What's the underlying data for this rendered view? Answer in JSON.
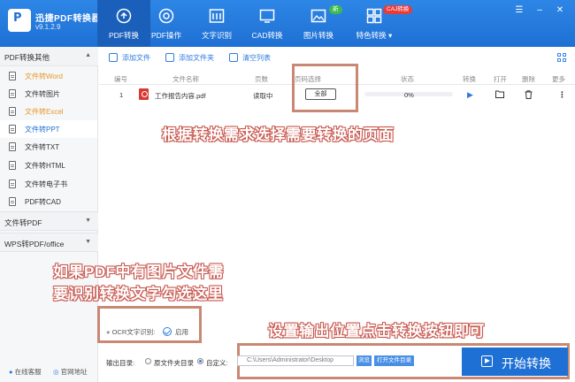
{
  "app": {
    "name": "迅捷PDF转换器",
    "version": "v9.1.2.9"
  },
  "nav": [
    {
      "label": "PDF转换",
      "icon": "pdf-convert-icon",
      "active": true
    },
    {
      "label": "PDF操作",
      "icon": "pdf-operate-icon"
    },
    {
      "label": "文字识别",
      "icon": "ocr-icon"
    },
    {
      "label": "CAD转换",
      "icon": "cad-icon"
    },
    {
      "label": "图片转换",
      "icon": "image-icon"
    },
    {
      "label": "特色转换 ▾",
      "icon": "special-icon"
    }
  ],
  "badges": {
    "new": "新",
    "cad": "CAJ转换"
  },
  "sidebar": {
    "group1": "PDF转换其他",
    "items": [
      {
        "label": "文件转Word",
        "highlight": true
      },
      {
        "label": "文件转图片"
      },
      {
        "label": "文件转Excel",
        "highlight": true
      },
      {
        "label": "文件转PPT",
        "active": true
      },
      {
        "label": "文件转TXT"
      },
      {
        "label": "文件转HTML"
      },
      {
        "label": "文件转电子书"
      },
      {
        "label": "PDF转CAD"
      }
    ],
    "group2": "文件转PDF",
    "group3": "WPS转PDF/office",
    "service": "在线客服",
    "website": "官网地址"
  },
  "toolbar": {
    "add_file": "添加文件",
    "add_folder": "添加文件夹",
    "clear_list": "清空列表"
  },
  "table": {
    "headers": [
      "编号",
      "文件名称",
      "页数",
      "页码选择",
      "状态",
      "转换",
      "打开",
      "删除",
      "更多"
    ],
    "rows": [
      {
        "num": "1",
        "name": "工作报告内容.pdf",
        "pages": "读取中",
        "page_select": "全部",
        "progress": 0,
        "status": "0%"
      }
    ]
  },
  "annotations": {
    "a1": "根据转换需求选择需要转换的页面",
    "a2_line1": "如果PDF中有图片文件需",
    "a2_line2": "要识别转换文字勾选这里",
    "a3": "设置输出位置点击转换按钮即可"
  },
  "bottom": {
    "ocr_label": "OCR文字识别:",
    "ocr_enable": "启用",
    "output_label": "输出目录:",
    "opt_source": "原文件夹目录",
    "opt_custom": "自定义:",
    "path": "C:\\Users\\Administrator\\Desktop",
    "browse": "浏览",
    "open_dir": "打开文件目录",
    "start": "开始转换"
  },
  "colors": {
    "brand": "#1f70d4",
    "annotation_border": "#c98874",
    "pdf_red": "#d63a35",
    "accent_orange": "#e39a2c"
  }
}
